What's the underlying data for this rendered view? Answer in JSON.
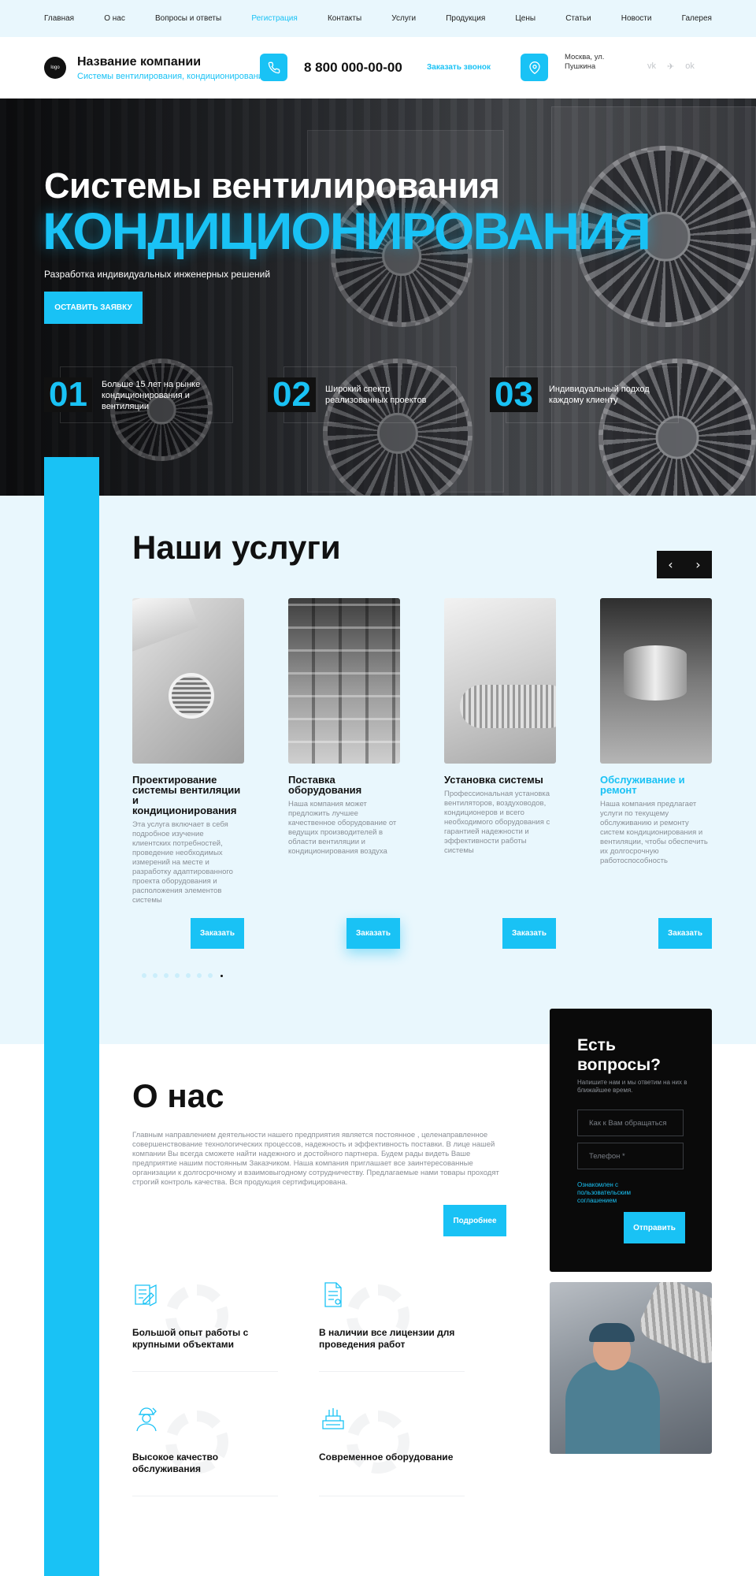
{
  "nav": {
    "items": [
      "Главная",
      "О нас",
      "Вопросы и ответы",
      "Регистрация",
      "Контакты",
      "Услуги",
      "Продукция",
      "Цены",
      "Статьи",
      "Новости",
      "Галерея"
    ],
    "active": "Регистрация"
  },
  "header": {
    "logo_text": "logo",
    "company_name": "Название компании",
    "company_subtitle": "Системы вентилирования, кондиционирования",
    "phone": "8 800 000-00-00",
    "callback_label": "Заказать звонок",
    "address": "Москва, ул. Пушкина",
    "socials": [
      {
        "icon": "vk-icon",
        "glyph": "vk"
      },
      {
        "icon": "telegram-icon",
        "glyph": "✈"
      },
      {
        "icon": "odnoklassniki-icon",
        "glyph": "ok"
      }
    ]
  },
  "hero": {
    "title_line1": "Системы вентилирования",
    "title_line2": "КОНДИЦИОНИРОВАНИЯ",
    "subtitle": "Разработка индивидуальных инженерных решений",
    "cta_label": "ОСТАВИТЬ ЗАЯВКУ",
    "features": [
      {
        "num": "01",
        "text": "Больше 15 лет на рынке кондиционирования и вентиляции"
      },
      {
        "num": "02",
        "text": "Широкий спектр реализованных проектов"
      },
      {
        "num": "03",
        "text": "Индивидуальный подход каждому клиенту"
      }
    ]
  },
  "services": {
    "title": "Наши услуги",
    "cards": [
      {
        "title": "Проектирование системы вентиляции и кондиционирования",
        "text": "Эта услуга включает в себя подробное изучение клиентских потребностей, проведение необходимых измерений на месте и разработку адаптированного проекта оборудования и расположения элементов системы",
        "button": "Заказать",
        "accent": false
      },
      {
        "title": "Поставка оборудования",
        "text": "Наша компания может предложить лучшее качественное оборудование от ведущих производителей в области вентиляции и кондиционирования воздуха",
        "button": "Заказать",
        "accent": false
      },
      {
        "title": "Установка системы",
        "text": "Профессиональная установка вентиляторов, воздуховодов, кондиционеров и всего необходимого оборудования с гарантией надежности и эффективности работы системы",
        "button": "Заказать",
        "accent": false
      },
      {
        "title": "Обслуживание и ремонт",
        "text": "Наша компания предлагает услуги по текущему обслуживанию и ремонту систем кондиционирования и вентиляции, чтобы обеспечить их долгосрочную работоспособность",
        "button": "Заказать",
        "accent": true
      }
    ],
    "dots_total": 8,
    "dot_active": 7
  },
  "about": {
    "title": "О нас",
    "text": "Главным направлением деятельности нашего предприятия является постоянное , целенаправленное совершенствование технологических процессов, надежность и эффективность поставки. В лице нашей компании Вы всегда сможете найти надежного и достойного партнера. Будем рады видеть Ваше предприятие нашим постоянным Заказчиком. Наша компания приглашает все заинтересованные организации к долгосрочному и взаимовыгодному сотрудничеству. Предлагаемые нами товары проходят строгий контроль качества. Вся продукция сертифицирована.",
    "button": "Подробнее",
    "advantages": [
      {
        "icon": "blueprint-icon",
        "title": "Большой опыт работы с крупными объектами"
      },
      {
        "icon": "license-document-icon",
        "title": "В наличии все лицензии для проведения работ"
      },
      {
        "icon": "engineer-icon",
        "title": "Высокое качество обслуживания"
      },
      {
        "icon": "equipment-icon",
        "title": "Современное оборудование"
      }
    ]
  },
  "contact_form": {
    "title": "Есть вопросы?",
    "subtitle": "Напишите нам и мы ответим на них в ближайшее время.",
    "name_placeholder": "Как к Вам обращаться",
    "phone_placeholder": "Телефон *",
    "agreement": "Ознакомлен с пользовательским соглашением",
    "submit": "Отправить"
  },
  "colors": {
    "accent": "#19c2f5",
    "light_bg": "#e9f7fd",
    "dark": "#0a0a0a",
    "muted_text": "#8a8f96"
  }
}
